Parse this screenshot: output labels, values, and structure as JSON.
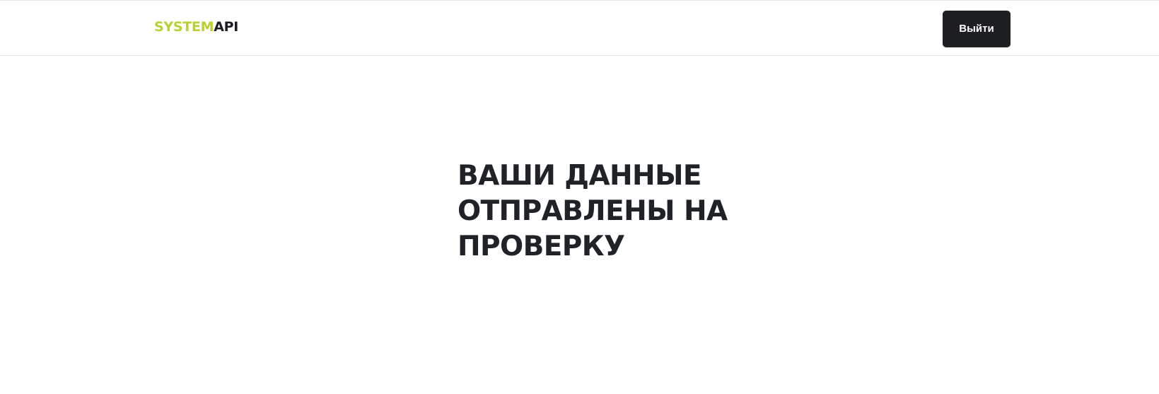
{
  "header": {
    "logo": {
      "accent_text": "SYSTEM",
      "dark_text": "API"
    },
    "logout_label": "Выйти"
  },
  "main": {
    "heading_lines": [
      "ВАШИ ДАННЫЕ",
      "ОТПРАВЛЕНЫ НА",
      "ПРОВЕРКУ"
    ]
  },
  "colors": {
    "logo_accent": "#b5d22f",
    "logo_dark": "#1b1d20",
    "button_bg": "#1e1f22",
    "button_text": "#ffffff",
    "heading_text": "#1f2327"
  }
}
